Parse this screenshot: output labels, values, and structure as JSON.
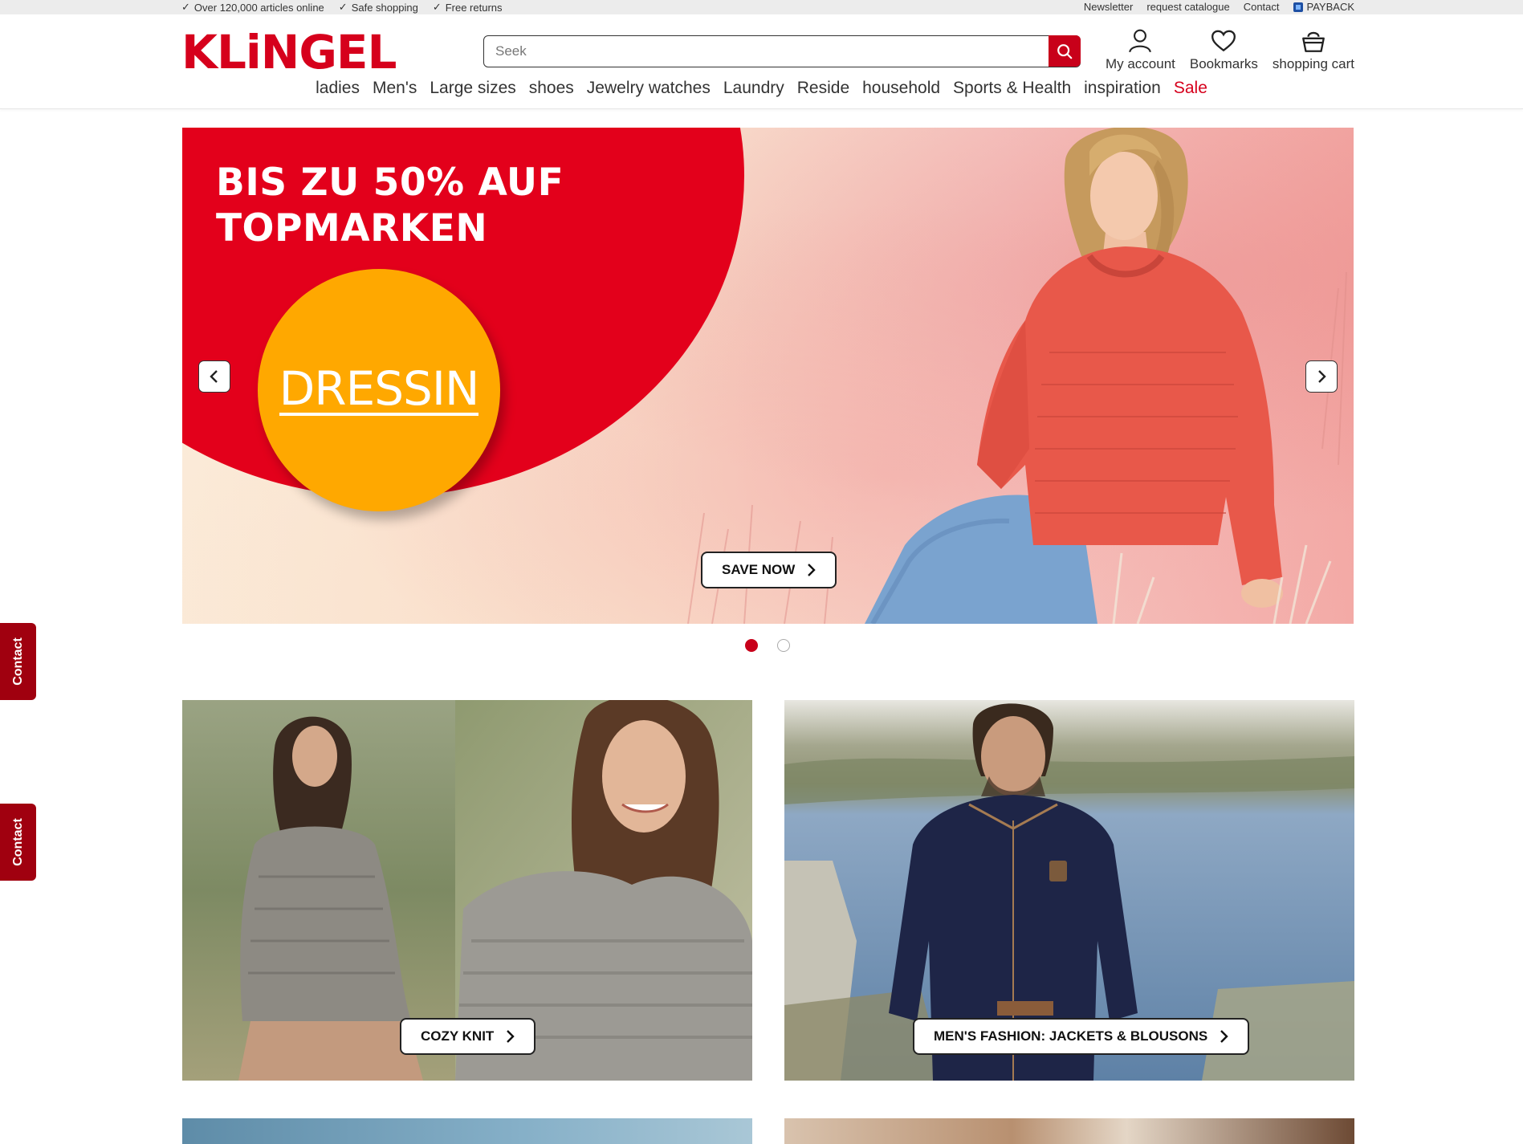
{
  "topbar": {
    "usps": [
      "Over 120,000 articles online",
      "Safe shopping",
      "Free returns"
    ],
    "links": [
      "Newsletter",
      "request catalogue",
      "Contact",
      "PAYBACK"
    ]
  },
  "header": {
    "logo": "KLiNGEL",
    "search": {
      "placeholder": "Seek",
      "value": "",
      "icon": "search-icon"
    },
    "actions": [
      {
        "label": "My account",
        "icon": "user-icon"
      },
      {
        "label": "Bookmarks",
        "icon": "heart-icon"
      },
      {
        "label": "shopping cart",
        "icon": "basket-icon"
      }
    ]
  },
  "nav": {
    "items": [
      "ladies",
      "Men's",
      "Large sizes",
      "shoes",
      "Jewelry watches",
      "Laundry",
      "Reside",
      "household",
      "Sports & Health",
      "inspiration"
    ],
    "sale": "Sale"
  },
  "hero": {
    "headline_line1": "BIS ZU 50% AUF",
    "headline_line2": "TOPMARKEN",
    "brand": "DRESSIN",
    "cta": "SAVE NOW",
    "slides_total": 2,
    "active_slide": 1
  },
  "side_tabs": [
    "Contact",
    "Contact"
  ],
  "tiles": [
    {
      "cta": "COZY KNIT"
    },
    {
      "cta": "MEN'S FASHION: JACKETS & BLOUSONS"
    }
  ],
  "colors": {
    "brand_red": "#d6001c",
    "dark_red": "#a0000f",
    "brand_orange": "#ffa800",
    "sale": "#d6001c"
  }
}
